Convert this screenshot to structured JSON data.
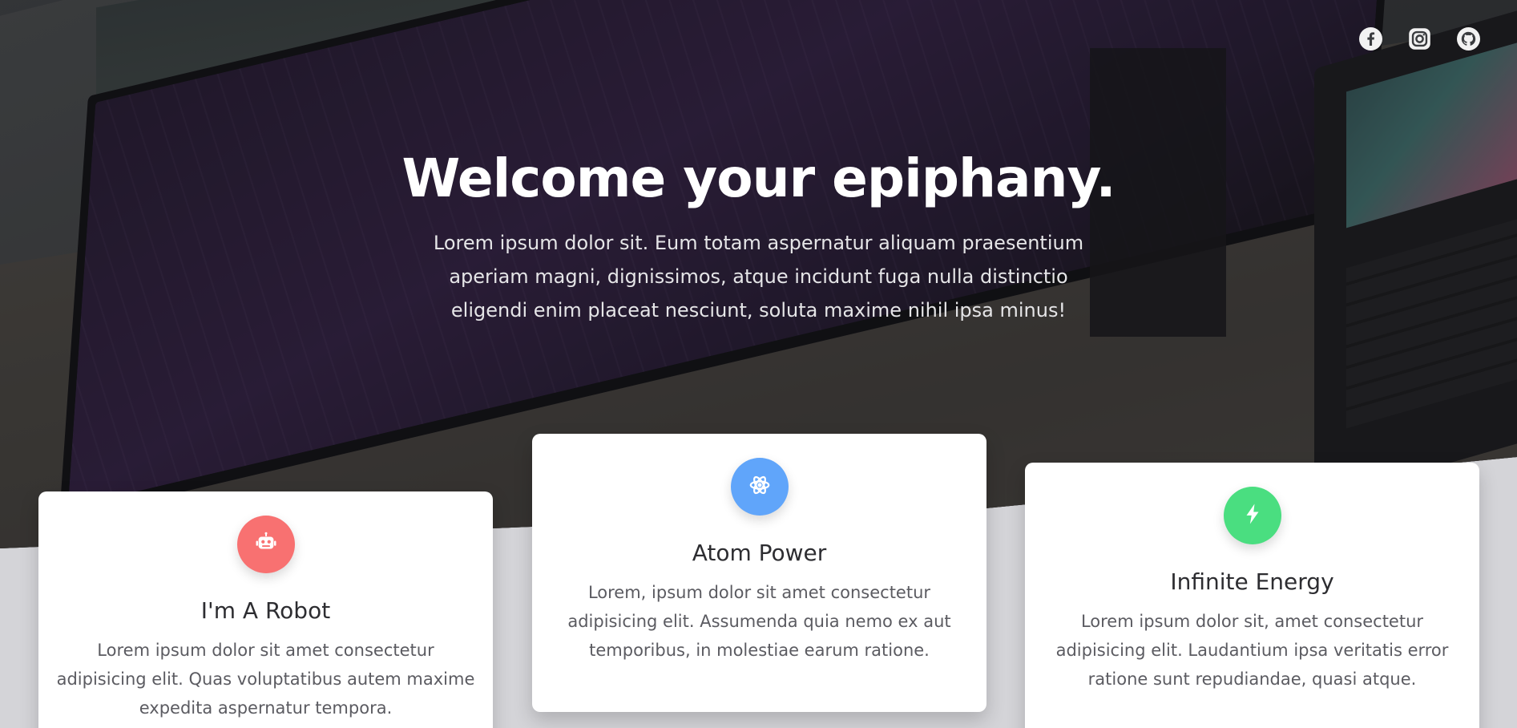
{
  "social": {
    "icons": [
      "facebook-icon",
      "instagram-icon",
      "github-icon"
    ]
  },
  "hero": {
    "title": "Welcome your epiphany.",
    "subtitle": "Lorem ipsum dolor sit. Eum totam aspernatur aliquam praesentium aperiam magni, dignissimos, atque incidunt fuga nulla distinctio eligendi enim placeat nesciunt, soluta maxime nihil ipsa minus!"
  },
  "cards": [
    {
      "icon": "robot-icon",
      "color": "#f87171",
      "title": "I'm A Robot",
      "text": "Lorem ipsum dolor sit amet consectetur adipisicing elit. Quas voluptatibus autem maxime expedita aspernatur tempora."
    },
    {
      "icon": "atom-icon",
      "color": "#60a5fa",
      "title": "Atom Power",
      "text": "Lorem, ipsum dolor sit amet consectetur adipisicing elit. Assumenda quia nemo ex aut temporibus, in molestiae earum ratione."
    },
    {
      "icon": "bolt-icon",
      "color": "#4ade80",
      "title": "Infinite Energy",
      "text": "Lorem ipsum dolor sit, amet consectetur adipisicing elit. Laudantium ipsa veritatis error ratione sunt repudiandae, quasi atque."
    }
  ],
  "colors": {
    "section_bg": "#d4d4d8",
    "card_bg": "#ffffff",
    "title_text": "#2d2d31",
    "body_text": "#5b5b61"
  }
}
